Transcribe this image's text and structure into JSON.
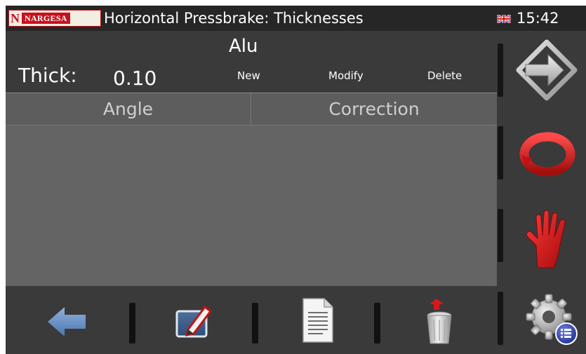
{
  "titlebar": {
    "logo_initial": "N",
    "logo_text": "NARGESA",
    "title": "Horizontal Pressbrake: Thicknesses",
    "language": "English (UK flag)",
    "time": "15:42"
  },
  "header": {
    "material": "Alu",
    "thick_label": "Thick:",
    "thick_value": "0.10",
    "actions": {
      "new": "New",
      "modify": "Modify",
      "delete": "Delete"
    }
  },
  "table": {
    "columns": [
      "Angle",
      "Correction"
    ],
    "rows": []
  },
  "side_buttons": [
    "next-arrow-icon",
    "refresh-icon",
    "stop-hand-icon",
    "settings-gear-icon"
  ],
  "bottom_buttons": [
    "back-arrow-icon",
    "edit-icon",
    "document-icon",
    "trash-icon"
  ],
  "colors": {
    "background": "#3a3a3a",
    "table": "#646464",
    "brand_red": "#c8101e",
    "accent_red": "#d01818"
  }
}
